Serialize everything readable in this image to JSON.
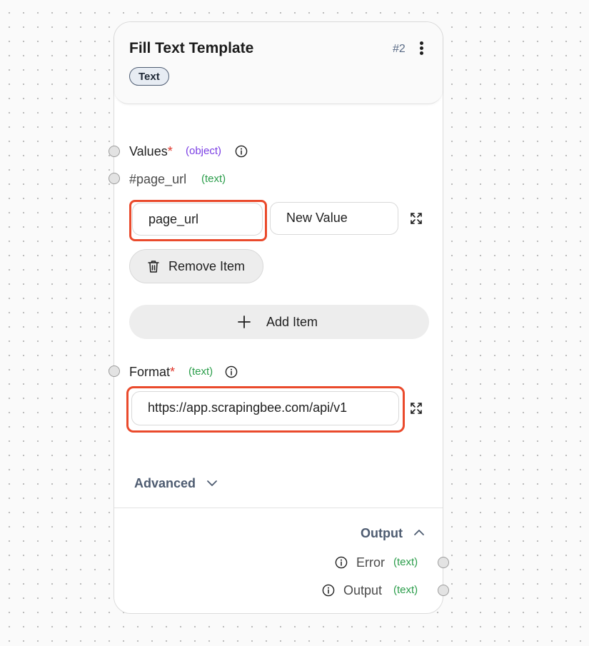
{
  "node": {
    "title": "Fill Text Template",
    "id": "#2",
    "tag": "Text"
  },
  "inputs": {
    "values": {
      "label": "Values",
      "required_mark": "*",
      "type": "(object)",
      "item_label": "#page_url",
      "item_type": "(text)",
      "key_value": "page_url",
      "value_placeholder": "New Value",
      "remove_label": "Remove Item",
      "add_label": "Add Item"
    },
    "format": {
      "label": "Format",
      "required_mark": "*",
      "type": "(text)",
      "value": "https://app.scrapingbee.com/api/v1"
    }
  },
  "advanced": {
    "label": "Advanced"
  },
  "outputs": {
    "toggle_label": "Output",
    "items": [
      {
        "label": "Error",
        "type": "(text)"
      },
      {
        "label": "Output",
        "type": "(text)"
      }
    ]
  },
  "colors": {
    "highlight": "#ea4a2c",
    "object_type": "#7b3fe4",
    "text_type": "#2a9d4a",
    "required": "#e0352a"
  },
  "icons": [
    "more-vertical-icon",
    "info-icon",
    "expand-icon",
    "trash-icon",
    "plus-icon",
    "chevron-down-icon",
    "chevron-up-icon"
  ]
}
